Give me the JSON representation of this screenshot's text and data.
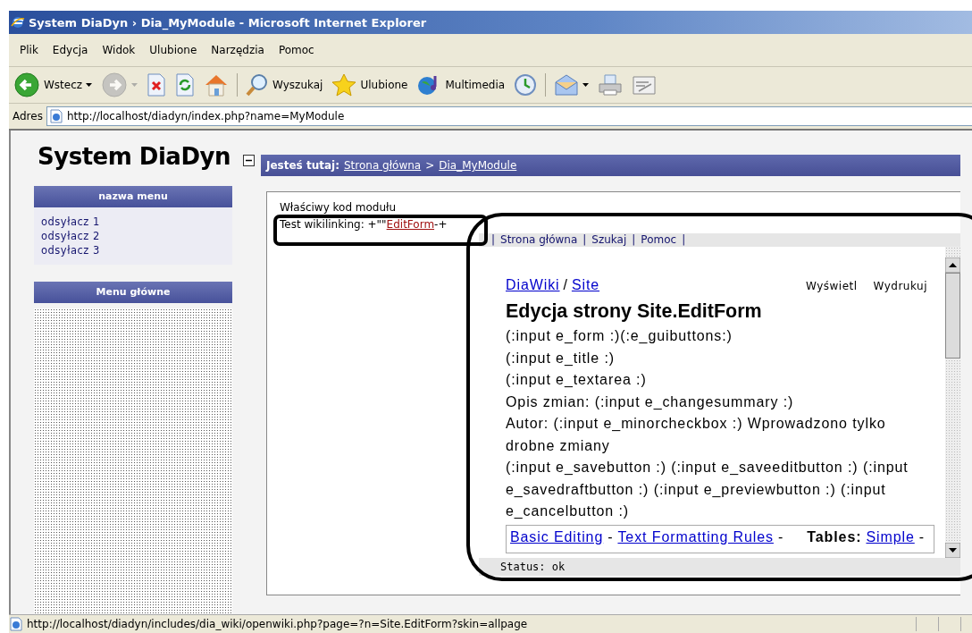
{
  "window": {
    "title": "System DiaDyn › Dia_MyModule - Microsoft Internet Explorer"
  },
  "menu": [
    "Plik",
    "Edycja",
    "Widok",
    "Ulubione",
    "Narzędzia",
    "Pomoc"
  ],
  "toolbar": [
    {
      "kind": "back",
      "label": "Wstecz",
      "dropdown": true,
      "disabled": false
    },
    {
      "kind": "forward",
      "dropdown": true,
      "disabled": true
    },
    {
      "kind": "stop",
      "dropdown": false,
      "disabled": false
    },
    {
      "kind": "refresh",
      "dropdown": false,
      "disabled": false
    },
    {
      "kind": "home",
      "dropdown": false,
      "disabled": false
    },
    {
      "kind": "separator"
    },
    {
      "kind": "search",
      "label": "Wyszukaj",
      "dropdown": false,
      "disabled": false
    },
    {
      "kind": "favorites",
      "label": "Ulubione",
      "dropdown": false,
      "disabled": false
    },
    {
      "kind": "media",
      "label": "Multimedia",
      "dropdown": false,
      "disabled": false
    },
    {
      "kind": "history",
      "dropdown": false,
      "disabled": false
    },
    {
      "kind": "separator"
    },
    {
      "kind": "mail",
      "dropdown": true,
      "disabled": false
    },
    {
      "kind": "print",
      "dropdown": false,
      "disabled": false
    },
    {
      "kind": "edit",
      "dropdown": false,
      "disabled": false
    }
  ],
  "address": {
    "label": "Adres",
    "url": "http://localhost/diadyn/index.php?name=MyModule"
  },
  "page": {
    "site_title": "System DiaDyn",
    "menus": [
      {
        "title": "nazwa menu",
        "links": [
          "odsyłacz 1",
          "odsyłacz 2",
          "odsyłacz 3"
        ]
      },
      {
        "title": "Menu główne"
      }
    ],
    "breadcrumb": {
      "label": "Jesteś tutaj:",
      "separator": ">",
      "items": [
        "Strona główna",
        "Dia_MyModule"
      ]
    },
    "module": {
      "heading": "Właściwy kod modułu",
      "test_prefix": "Test wikilinking: +\"\"",
      "test_link": "EditForm",
      "test_suffix": "-+"
    },
    "wiki_nav": {
      "separator": "|",
      "items": [
        "Strona główna",
        "Szukaj",
        "Pomoc"
      ]
    },
    "wiki": {
      "path": [
        "DiaWiki",
        "Site"
      ],
      "path_separator": "/",
      "actions": [
        "Wyświetl",
        "Wydrukuj"
      ],
      "heading": "Edycja strony Site.EditForm",
      "lines": [
        "(:input e_form :)(:e_guibuttons:)",
        "(:input e_title :)",
        "(:input e_textarea :)",
        "Opis zmian: (:input e_changesummary :)",
        "Autor: (:input e_minorcheckbox :) Wprowadzono tylko drobne zmiany",
        "(:input e_savebutton :) (:input e_saveeditbutton :) (:input e_savedraftbutton :) (:input e_previewbutton :) (:input e_cancelbutton :)"
      ],
      "link_separator": "-",
      "footer_links": [
        "Basic Editing",
        "Text Formatting Rules"
      ],
      "footer_label": "Tables:",
      "footer_right_links": [
        "Simple"
      ]
    },
    "frame_status": "Status: ok"
  },
  "status_bar": {
    "url": "http://localhost/diadyn/includes/dia_wiki/openwiki.php?page=?n=Site.EditForm?skin=allpage"
  }
}
